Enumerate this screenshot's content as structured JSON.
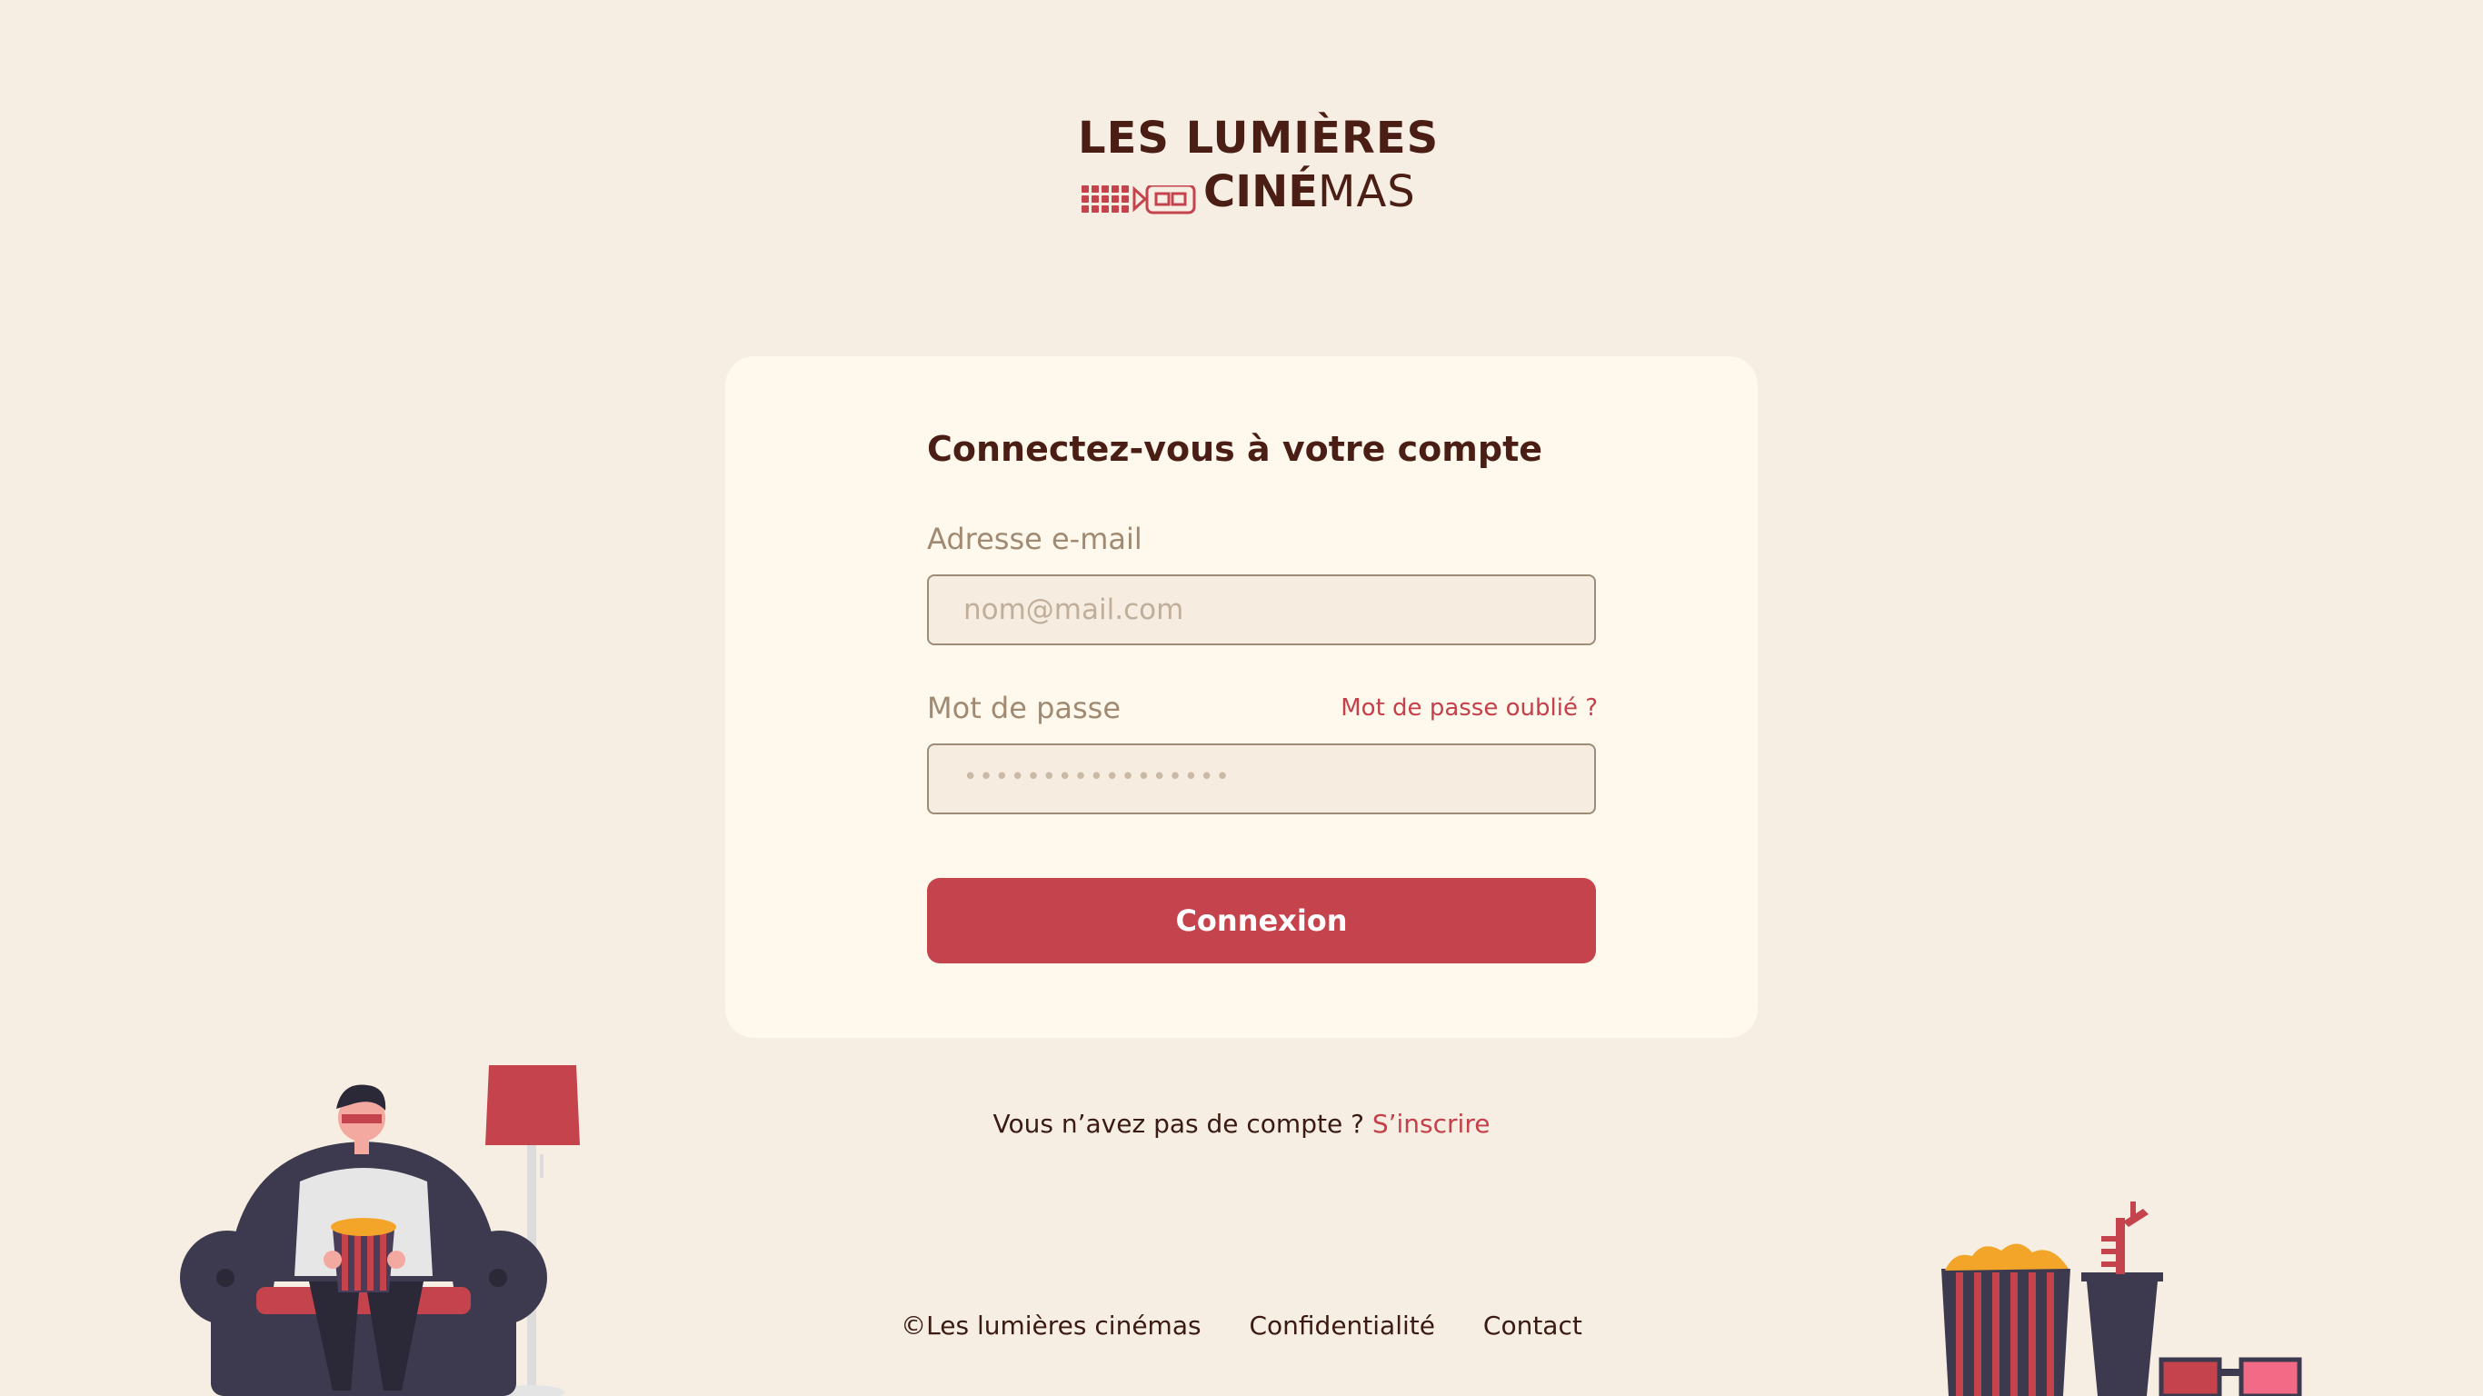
{
  "logo": {
    "line1": "LES LUMIÈRES",
    "line2_bold": "CINÉ",
    "line2_light": "MAS"
  },
  "login": {
    "title": "Connectez-vous à votre compte",
    "email_label": "Adresse e-mail",
    "email_placeholder": "nom@mail.com",
    "password_label": "Mot de passe",
    "forgot_link": "Mot de passe oublié ?",
    "password_masked": "•••••••••••••••••",
    "submit_label": "Connexion"
  },
  "signup": {
    "question": "Vous n’avez pas de compte ? ",
    "link": "S’inscrire"
  },
  "footer": {
    "copyright": "©Les lumières cinémas",
    "privacy": "Confidentialité",
    "contact": "Contact"
  },
  "colors": {
    "background": "#f6eee2",
    "card": "#fff8ec",
    "accent": "#c5434c",
    "brand_dark": "#4a1e14"
  },
  "icons": [
    "film-camera-logo-icon",
    "person-on-armchair-illustration",
    "popcorn-drink-glasses-illustration"
  ]
}
